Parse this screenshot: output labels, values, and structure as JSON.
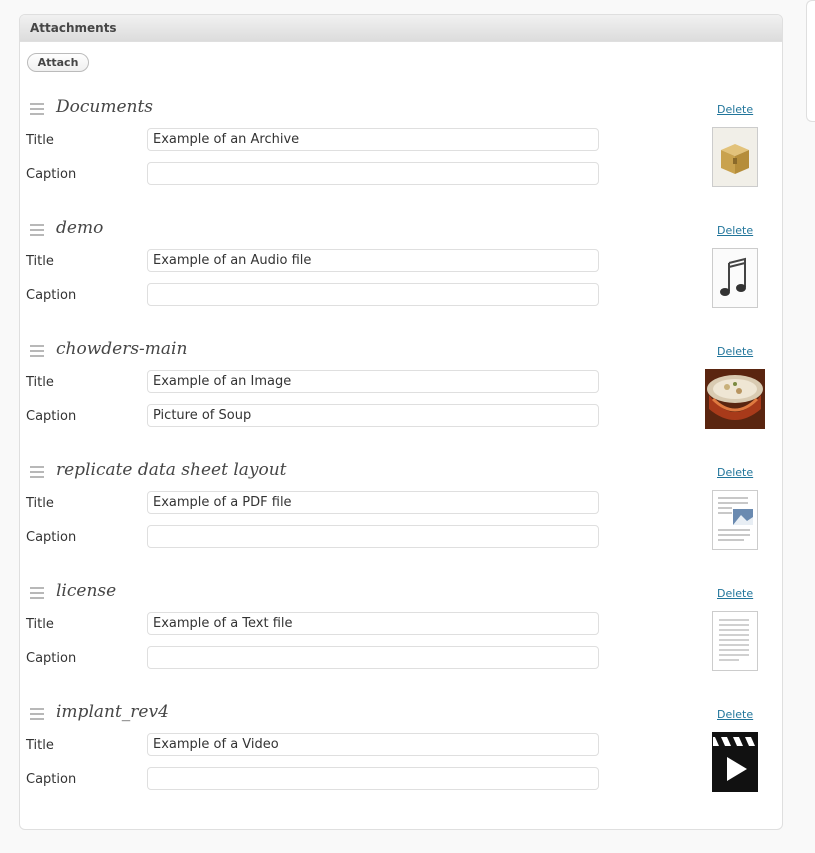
{
  "metabox": {
    "title": "Attachments",
    "attach_label": "Attach"
  },
  "labels": {
    "title": "Title",
    "caption": "Caption",
    "delete": "Delete"
  },
  "attachments": [
    {
      "name": "Documents",
      "title": "Example of an Archive",
      "caption": "",
      "thumb": "archive-icon"
    },
    {
      "name": "demo",
      "title": "Example of an Audio file",
      "caption": "",
      "thumb": "audio-icon"
    },
    {
      "name": "chowders-main",
      "title": "Example of an Image",
      "caption": "Picture of Soup",
      "thumb": "soup-image"
    },
    {
      "name": "replicate data sheet layout",
      "title": "Example of a PDF file",
      "caption": "",
      "thumb": "pdf-icon"
    },
    {
      "name": "license",
      "title": "Example of a Text file",
      "caption": "",
      "thumb": "text-document-icon"
    },
    {
      "name": "implant_rev4",
      "title": "Example of a Video",
      "caption": "",
      "thumb": "video-icon"
    }
  ]
}
